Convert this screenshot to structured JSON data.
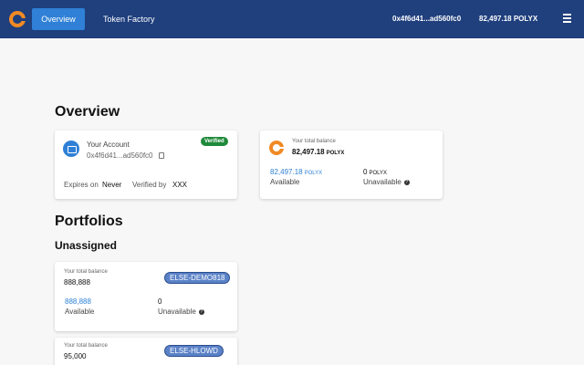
{
  "header": {
    "nav_overview": "Overview",
    "nav_token_factory": "Token Factory",
    "address": "0x4f6d41...ad560fc0",
    "balance": "82,497.18 POLYX"
  },
  "overview": {
    "title": "Overview",
    "account": {
      "label": "Your Account",
      "address": "0x4f6d41...ad560fc0",
      "badge": "Verified",
      "expires_label": "Expires on",
      "expires_value": "Never",
      "verified_by_label": "Verified by",
      "verified_by_value": "XXX"
    },
    "balance": {
      "label": "Your total balance",
      "total": "82,497.18",
      "unit": "POLYX",
      "available_value": "82,497.18",
      "available_unit": "POLYX",
      "available_label": "Available",
      "unavailable_value": "0",
      "unavailable_unit": "POLYX",
      "unavailable_label": "Unavailable"
    }
  },
  "portfolios": {
    "title": "Portfolios",
    "subtitle": "Unassigned",
    "items": [
      {
        "label": "Your total balance",
        "total": "888,888",
        "tag": "ELSE-DEMO818",
        "available_value": "888,888",
        "available_label": "Available",
        "unavailable_value": "0",
        "unavailable_label": "Unavailable"
      },
      {
        "label": "Your total balance",
        "total": "95,000",
        "tag": "ELSE-HLOWD"
      }
    ]
  }
}
